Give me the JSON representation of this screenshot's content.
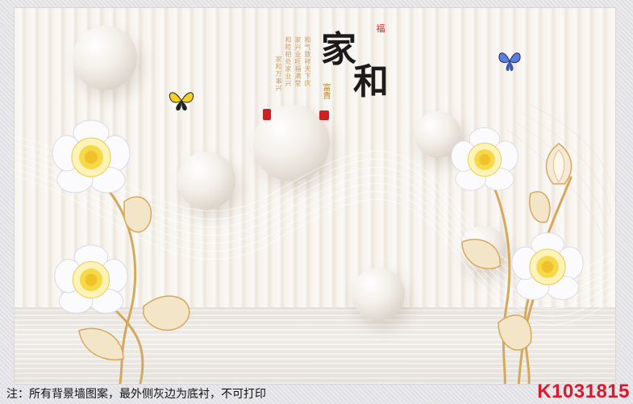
{
  "calligraphy": {
    "main_char_1": "家",
    "main_char_2": "和",
    "small_seal_top": "福",
    "side_text": "富貴",
    "verse_col_1": "和气致祥天下庆",
    "verse_col_2": "家兴业旺福满堂",
    "verse_col_3": "和睦相处家业兴",
    "verse_col_4": "家和万事兴"
  },
  "footer": {
    "note": "注：所有背景墙图案，最外侧灰边为底衬，不可打印",
    "product_code": "K1031815"
  },
  "colors": {
    "code_red": "#e0162b",
    "gold": "#c9a26a",
    "ink": "#1c1a1a"
  }
}
